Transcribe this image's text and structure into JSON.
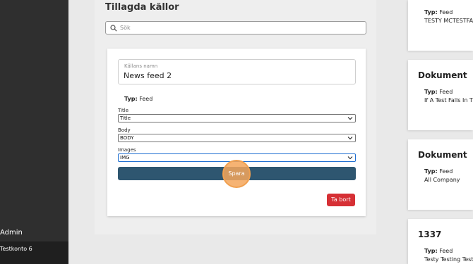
{
  "sidebar": {
    "admin_label": "Admin",
    "account_label": "Testkonto 6"
  },
  "main": {
    "title": "Tillagda källor",
    "search_placeholder": "Sök",
    "form": {
      "name_label": "Källans namn",
      "name_value": "News feed 2",
      "type_label": "Typ:",
      "type_value": "Feed",
      "fields": [
        {
          "label": "Title",
          "value": "Title"
        },
        {
          "label": "Body",
          "value": "BODY"
        },
        {
          "label": "Images",
          "value": "IMG"
        }
      ],
      "save_label": "Spara",
      "delete_label": "Ta bort"
    }
  },
  "right_cards": [
    {
      "title": "",
      "type_label": "Typ:",
      "type_value": "Feed",
      "subtitle": "TESTY MCTESTFACE"
    },
    {
      "title": "Dokument",
      "type_label": "Typ:",
      "type_value": "Feed",
      "subtitle": "If A Test Falls In The"
    },
    {
      "title": "Dokument",
      "type_label": "Typ:",
      "type_value": "Feed",
      "subtitle": "All Company"
    },
    {
      "title": "1337",
      "type_label": "Typ:",
      "type_value": "Feed",
      "subtitle": "Testy Testing Test"
    }
  ],
  "colors": {
    "sidebar_bg": "#2f2f2f",
    "primary_button": "#2e5670",
    "danger_button": "#d63035",
    "click_highlight": "#f0a050"
  }
}
